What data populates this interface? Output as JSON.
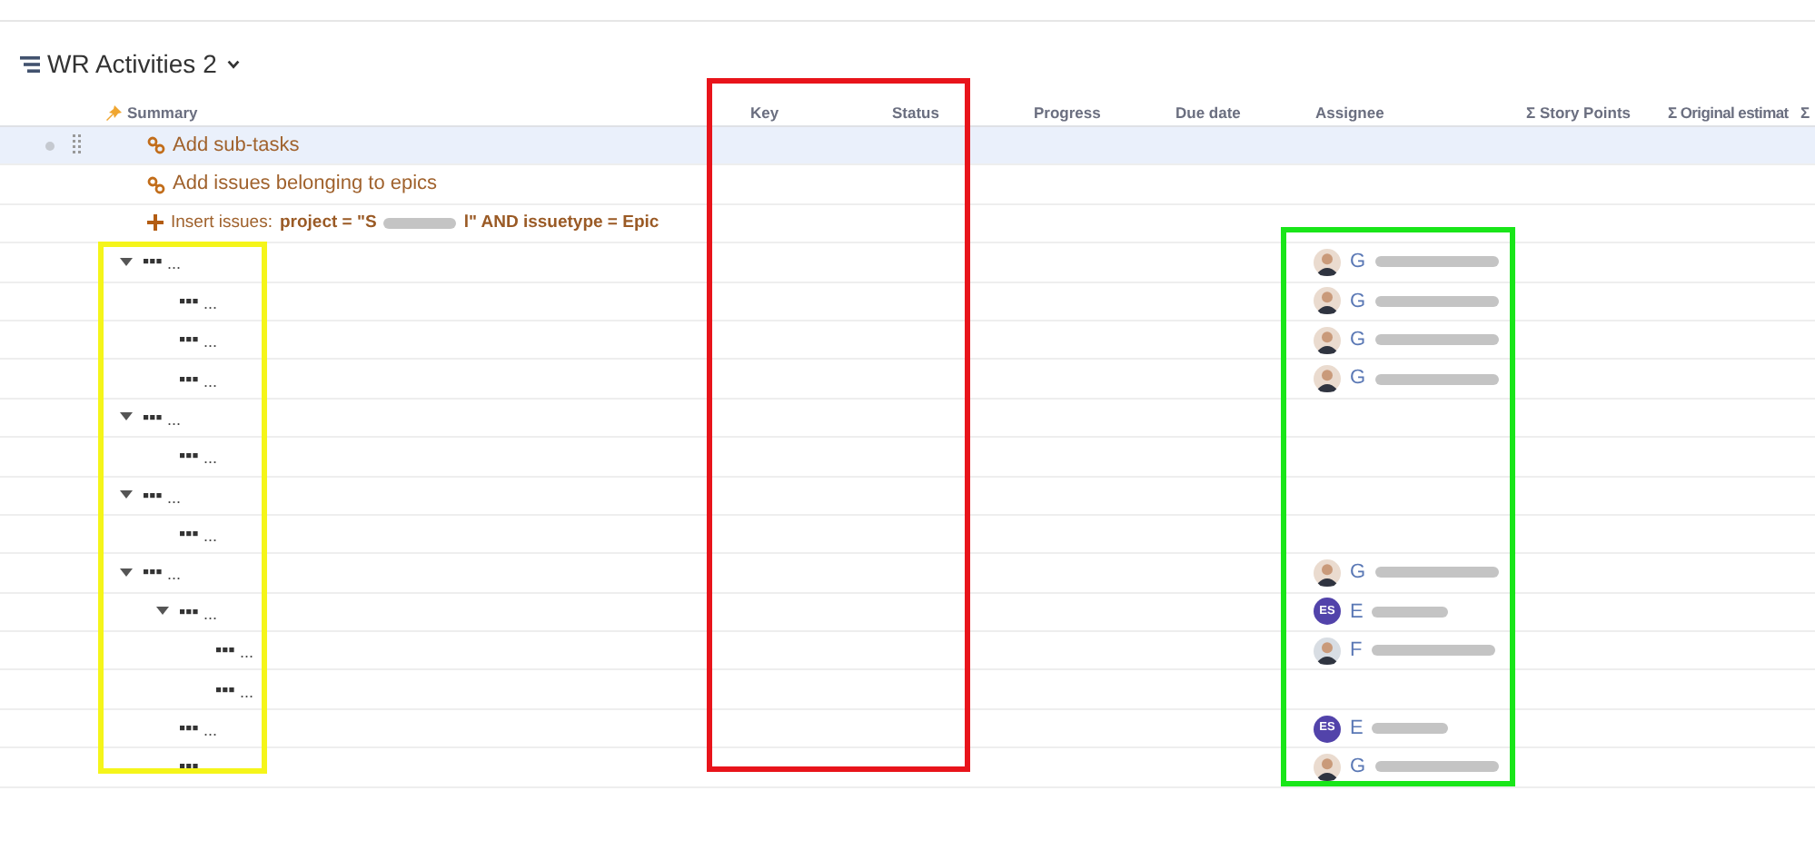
{
  "structure": {
    "title": "WR Activities 2"
  },
  "columns": [
    "Summary",
    "Key",
    "Status",
    "Progress",
    "Due date",
    "Assignee",
    "Σ Story Points",
    "Σ Original estimat",
    "Σ"
  ],
  "action_rows": [
    {
      "kind": "link",
      "label": "Add sub-tasks",
      "selected": true
    },
    {
      "kind": "link",
      "label": "Add issues belonging to epics",
      "selected": false
    },
    {
      "kind": "insert",
      "label": "Insert issues:",
      "query_start": "project = \"S",
      "query_end": "l\" AND issuetype = Epic",
      "selected": false
    }
  ],
  "issues": [
    {
      "summary": "...",
      "expanded": true,
      "assignee": {
        "kind": "photo",
        "initial": "G"
      },
      "children": [
        {
          "summary": "...",
          "assignee": {
            "kind": "photo",
            "initial": "G"
          }
        },
        {
          "summary": "...",
          "assignee": {
            "kind": "photo",
            "initial": "G"
          }
        },
        {
          "summary": "...",
          "assignee": {
            "kind": "photo",
            "initial": "G"
          }
        }
      ]
    },
    {
      "summary": "...",
      "expanded": true,
      "children": [
        {
          "summary": "..."
        }
      ]
    },
    {
      "summary": "...",
      "expanded": true,
      "children": [
        {
          "summary": "..."
        }
      ]
    },
    {
      "summary": "...",
      "expanded": true,
      "assignee": {
        "kind": "photo",
        "initial": "G"
      },
      "children": [
        {
          "summary": "...",
          "expanded": true,
          "assignee": {
            "kind": "initials",
            "initials": "ES",
            "initial": "E"
          },
          "children": [
            {
              "summary": "...",
              "assignee": {
                "kind": "snapshot",
                "initial": "F"
              }
            },
            {
              "summary": "..."
            }
          ]
        },
        {
          "summary": "...",
          "assignee": {
            "kind": "initials",
            "initials": "ES",
            "initial": "E"
          }
        },
        {
          "assignee": {
            "kind": "photo",
            "initial": "G"
          }
        }
      ]
    }
  ],
  "annotations": [
    {
      "color": "#e8141b"
    },
    {
      "color": "#f5f51a"
    },
    {
      "color": "#19e619"
    }
  ]
}
